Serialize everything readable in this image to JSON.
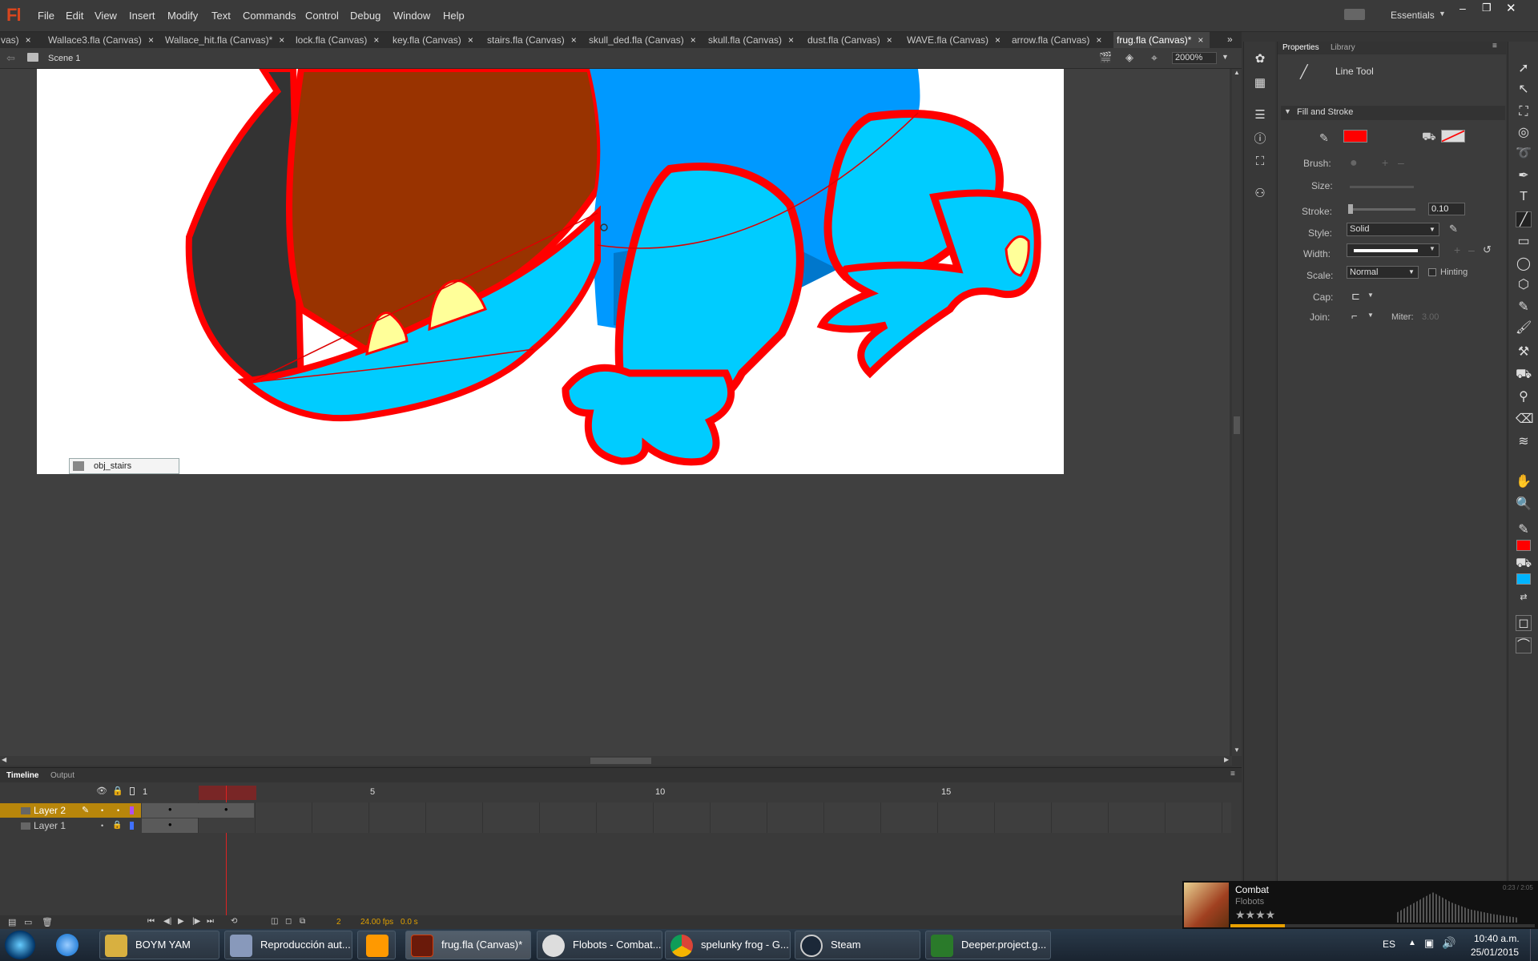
{
  "app": {
    "logo": "Fl"
  },
  "menu": [
    "File",
    "Edit",
    "View",
    "Insert",
    "Modify",
    "Text",
    "Commands",
    "Control",
    "Debug",
    "Window",
    "Help"
  ],
  "workspace": {
    "label": "Essentials"
  },
  "tabs": [
    {
      "label": "vas)"
    },
    {
      "label": "Wallace3.fla (Canvas)"
    },
    {
      "label": "Wallace_hit.fla (Canvas)*"
    },
    {
      "label": "lock.fla (Canvas)"
    },
    {
      "label": "key.fla (Canvas)"
    },
    {
      "label": "stairs.fla (Canvas)"
    },
    {
      "label": "skull_ded.fla (Canvas)"
    },
    {
      "label": "skull.fla (Canvas)"
    },
    {
      "label": "dust.fla (Canvas)"
    },
    {
      "label": "WAVE.fla (Canvas)"
    },
    {
      "label": "arrow.fla (Canvas)"
    },
    {
      "label": "frug.fla (Canvas)*"
    }
  ],
  "editbar": {
    "scene": "Scene 1",
    "zoom": "2000%"
  },
  "stage": {
    "tooltip": "obj_stairs"
  },
  "timeline": {
    "tabs": [
      "Timeline",
      "Output"
    ],
    "layers": [
      {
        "name": "Layer 2"
      },
      {
        "name": "Layer 1"
      }
    ],
    "frame_numbers": [
      "1",
      "5",
      "10",
      "15"
    ],
    "current_frame": "2",
    "fps": "24.00 fps",
    "time": "0.0 s"
  },
  "properties": {
    "tabs": [
      "Properties",
      "Library"
    ],
    "tool_name": "Line Tool",
    "section": "Fill and Stroke",
    "brush_label": "Brush:",
    "size_label": "Size:",
    "stroke_label": "Stroke:",
    "stroke_value": "0.10",
    "style_label": "Style:",
    "style_value": "Solid",
    "width_label": "Width:",
    "scale_label": "Scale:",
    "scale_value": "Normal",
    "hinting_label": "Hinting",
    "cap_label": "Cap:",
    "join_label": "Join:",
    "miter_label": "Miter:",
    "miter_value": "3.00",
    "stroke_color": "#ff0000"
  },
  "media": {
    "title": "Combat",
    "artist": "Flobots",
    "time": "0:23 / 2:05"
  },
  "taskbar": {
    "items": [
      {
        "label": "BOYM YAM"
      },
      {
        "label": "Reproducción aut..."
      },
      {
        "label": ""
      },
      {
        "label": "frug.fla (Canvas)*"
      },
      {
        "label": "Flobots - Combat..."
      },
      {
        "label": "spelunky frog - G..."
      },
      {
        "label": "Steam"
      },
      {
        "label": "Deeper.project.g..."
      }
    ],
    "lang": "ES",
    "clock_time": "10:40 a.m.",
    "clock_date": "25/01/2015"
  }
}
